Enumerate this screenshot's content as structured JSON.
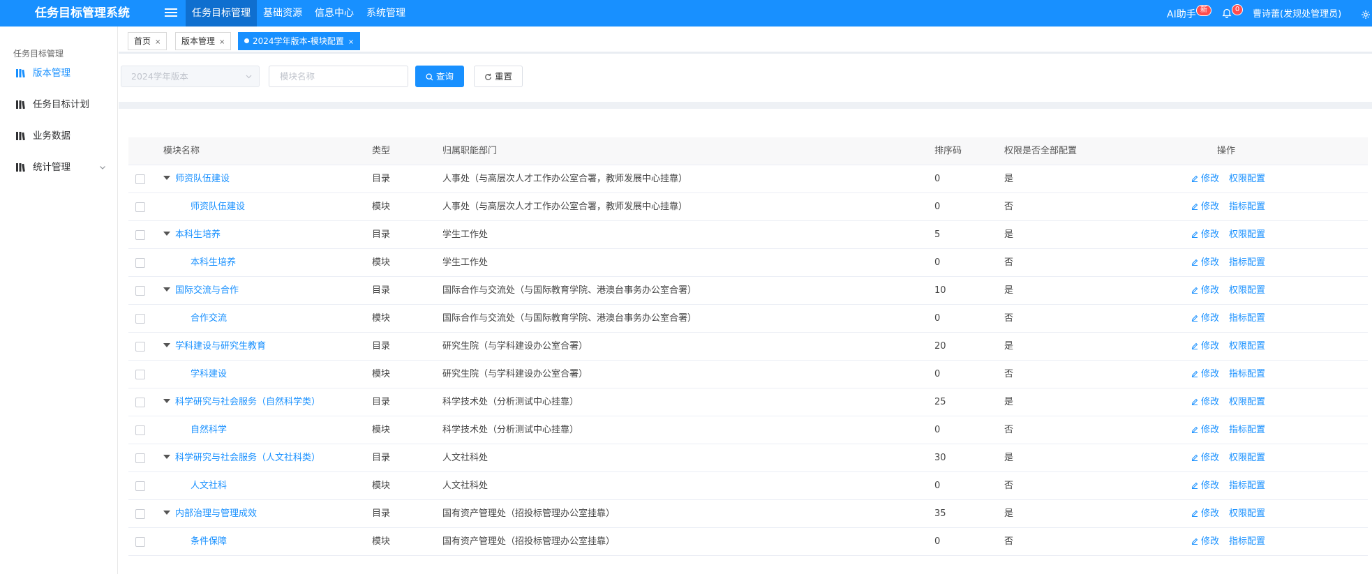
{
  "app": {
    "title": "任务目标管理系统"
  },
  "topnav": [
    {
      "label": "任务目标管理",
      "active": true
    },
    {
      "label": "基础资源",
      "active": false
    },
    {
      "label": "信息中心",
      "active": false
    },
    {
      "label": "系统管理",
      "active": false
    }
  ],
  "header": {
    "ai_label": "AI助手",
    "ai_badge": "新",
    "notification_count": "0",
    "user": "曹诗蕾(发规处管理员)"
  },
  "sidebar": {
    "section": "任务目标管理",
    "items": [
      {
        "label": "版本管理",
        "active": true
      },
      {
        "label": "任务目标计划",
        "active": false
      },
      {
        "label": "业务数据",
        "active": false
      },
      {
        "label": "统计管理",
        "active": false,
        "expandable": true
      }
    ]
  },
  "tabs": [
    {
      "label": "首页",
      "active": false
    },
    {
      "label": "版本管理",
      "active": false
    },
    {
      "label": "2024学年版本-模块配置",
      "active": true
    }
  ],
  "filter": {
    "version_select": "2024学年版本",
    "module_placeholder": "模块名称",
    "query_label": "查询",
    "reset_label": "重置"
  },
  "table": {
    "columns": [
      "模块名称",
      "类型",
      "归属职能部门",
      "排序码",
      "权限是否全部配置",
      "操作"
    ],
    "rows": [
      {
        "name": "师资队伍建设",
        "level": 0,
        "type": "目录",
        "dept": "人事处（与高层次人才工作办公室合署，教师发展中心挂靠）",
        "sort": "0",
        "perm": "是",
        "op1": "修改",
        "op2": "权限配置"
      },
      {
        "name": "师资队伍建设",
        "level": 1,
        "type": "模块",
        "dept": "人事处（与高层次人才工作办公室合署，教师发展中心挂靠）",
        "sort": "0",
        "perm": "否",
        "op1": "修改",
        "op2": "指标配置"
      },
      {
        "name": "本科生培养",
        "level": 0,
        "type": "目录",
        "dept": "学生工作处",
        "sort": "5",
        "perm": "是",
        "op1": "修改",
        "op2": "权限配置"
      },
      {
        "name": "本科生培养",
        "level": 1,
        "type": "模块",
        "dept": "学生工作处",
        "sort": "0",
        "perm": "否",
        "op1": "修改",
        "op2": "指标配置"
      },
      {
        "name": "国际交流与合作",
        "level": 0,
        "type": "目录",
        "dept": "国际合作与交流处（与国际教育学院、港澳台事务办公室合署）",
        "sort": "10",
        "perm": "是",
        "op1": "修改",
        "op2": "权限配置"
      },
      {
        "name": "合作交流",
        "level": 1,
        "type": "模块",
        "dept": "国际合作与交流处（与国际教育学院、港澳台事务办公室合署）",
        "sort": "0",
        "perm": "否",
        "op1": "修改",
        "op2": "指标配置"
      },
      {
        "name": "学科建设与研究生教育",
        "level": 0,
        "type": "目录",
        "dept": "研究生院（与学科建设办公室合署）",
        "sort": "20",
        "perm": "是",
        "op1": "修改",
        "op2": "权限配置"
      },
      {
        "name": "学科建设",
        "level": 1,
        "type": "模块",
        "dept": "研究生院（与学科建设办公室合署）",
        "sort": "0",
        "perm": "否",
        "op1": "修改",
        "op2": "指标配置"
      },
      {
        "name": "科学研究与社会服务（自然科学类）",
        "level": 0,
        "type": "目录",
        "dept": "科学技术处（分析测试中心挂靠）",
        "sort": "25",
        "perm": "是",
        "op1": "修改",
        "op2": "权限配置"
      },
      {
        "name": "自然科学",
        "level": 1,
        "type": "模块",
        "dept": "科学技术处（分析测试中心挂靠）",
        "sort": "0",
        "perm": "否",
        "op1": "修改",
        "op2": "指标配置"
      },
      {
        "name": "科学研究与社会服务（人文社科类）",
        "level": 0,
        "type": "目录",
        "dept": "人文社科处",
        "sort": "30",
        "perm": "是",
        "op1": "修改",
        "op2": "权限配置"
      },
      {
        "name": "人文社科",
        "level": 1,
        "type": "模块",
        "dept": "人文社科处",
        "sort": "0",
        "perm": "否",
        "op1": "修改",
        "op2": "指标配置"
      },
      {
        "name": "内部治理与管理成效",
        "level": 0,
        "type": "目录",
        "dept": "国有资产管理处（招投标管理办公室挂靠）",
        "sort": "35",
        "perm": "是",
        "op1": "修改",
        "op2": "权限配置"
      },
      {
        "name": "条件保障",
        "level": 1,
        "type": "模块",
        "dept": "国有资产管理处（招投标管理办公室挂靠）",
        "sort": "0",
        "perm": "否",
        "op1": "修改",
        "op2": "指标配置"
      }
    ]
  },
  "colors": {
    "primary": "#1890ff",
    "header_active": "#0f6fcf",
    "badge": "#ff4d4f"
  }
}
